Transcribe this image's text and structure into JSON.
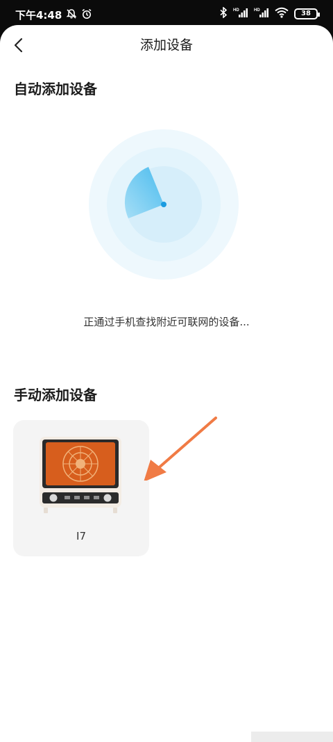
{
  "status_bar": {
    "time": "下午4:48",
    "signal_label_1": "HD",
    "signal_label_2": "HD",
    "battery": "38"
  },
  "nav": {
    "title": "添加设备"
  },
  "auto_section": {
    "title": "自动添加设备",
    "scan_status": "正通过手机查找附近可联网的设备..."
  },
  "manual_section": {
    "title": "手动添加设备",
    "devices": [
      {
        "name": "I7"
      }
    ]
  },
  "colors": {
    "radar_outer": "#eef8fd",
    "radar_mid": "#e3f4fc",
    "radar_inner": "#d6eefa",
    "radar_sweep": "#5bc4f0",
    "annotation_arrow": "#f07b45"
  },
  "icons": [
    "back-arrow-icon",
    "mute-bell-icon",
    "alarm-icon",
    "bluetooth-icon",
    "signal-icon",
    "wifi-icon",
    "battery-icon"
  ]
}
